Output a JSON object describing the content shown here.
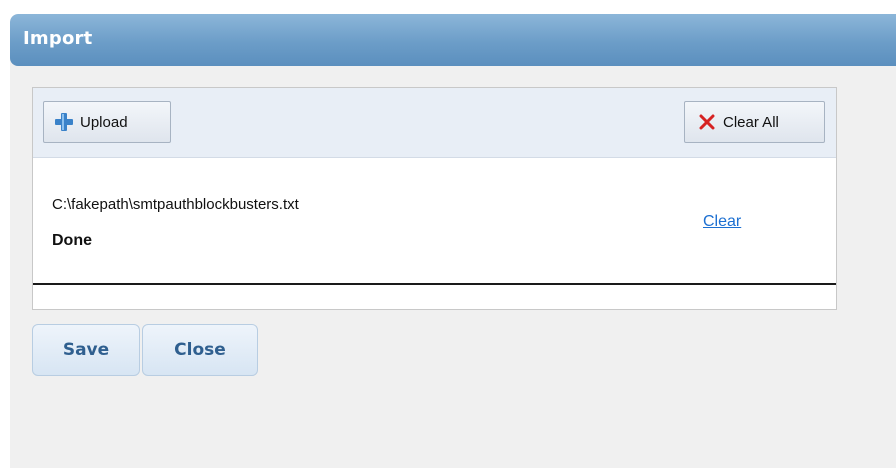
{
  "dialog": {
    "title": "Import"
  },
  "toolbar": {
    "upload_label": "Upload",
    "upload_icon": "plus-icon",
    "clear_all_label": "Clear All",
    "clear_all_icon": "x-icon"
  },
  "file": {
    "path": "C:\\fakepath\\smtpauthblockbusters.txt",
    "status": "Done",
    "clear_label": "Clear"
  },
  "footer": {
    "save_label": "Save",
    "close_label": "Close"
  },
  "colors": {
    "title_bar": "#6c9dc8",
    "plus_icon": "#3a82c9",
    "x_icon": "#d62222",
    "link": "#1c6fd1",
    "footer_button_text": "#2f5f8f"
  }
}
